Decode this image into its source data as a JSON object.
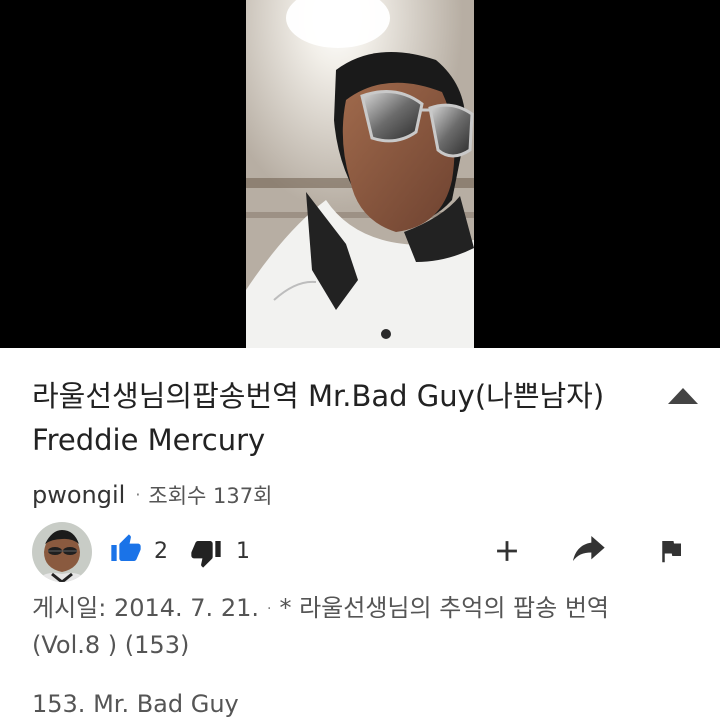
{
  "video": {
    "title": "라울선생님의팝송번역 Mr.Bad Guy(나쁜남자) Freddie Mercury"
  },
  "channel": {
    "name": "pwongil",
    "views": "조회수 137회"
  },
  "actions": {
    "like_count": "2",
    "dislike_count": "1",
    "accent_color": "#1a73e8",
    "icon_color": "#222222"
  },
  "description": {
    "date_text": "게시일: 2014. 7. 21.",
    "playlist_text": "* 라울선생님의 추억의 팝송 번역 (Vol.8 ) (153)",
    "line2": "153. Mr. Bad Guy"
  }
}
